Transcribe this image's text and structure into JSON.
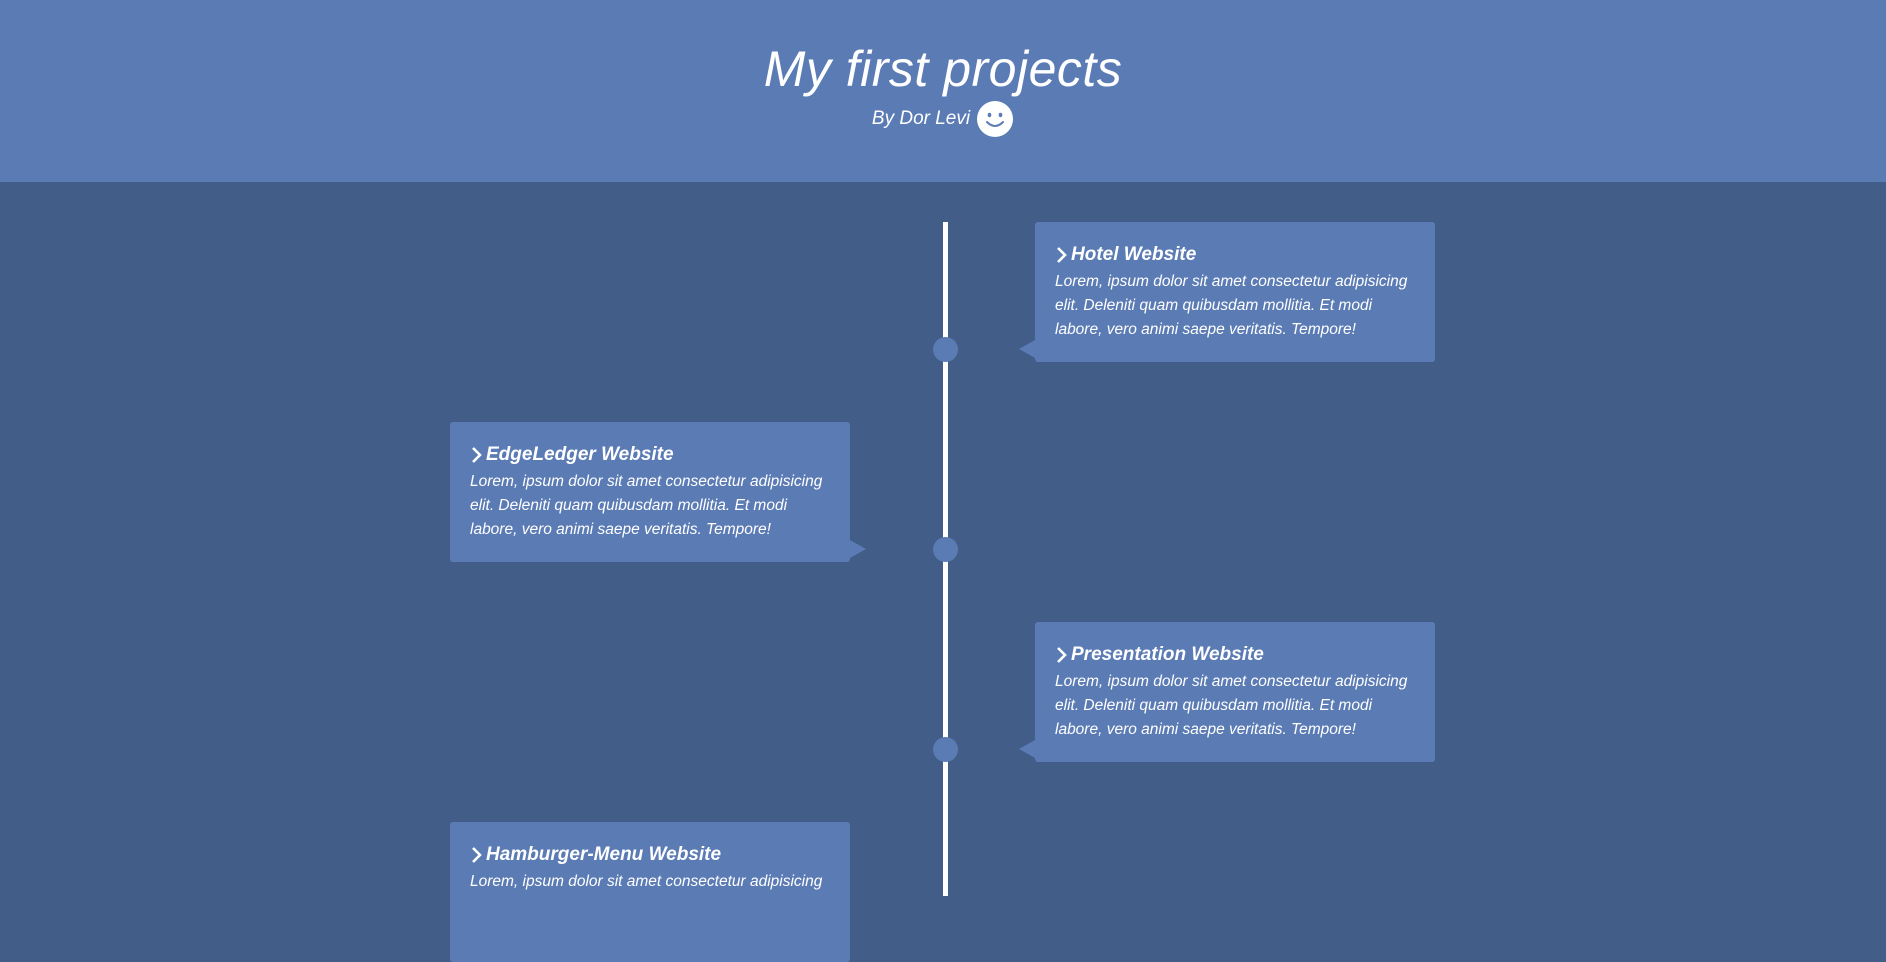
{
  "header": {
    "title": "My first projects",
    "byline": "By Dor Levi",
    "emoji_icon": "smiley-face-icon"
  },
  "timeline": {
    "items": [
      {
        "title": "Hotel Website",
        "description": "Lorem, ipsum dolor sit amet consectetur adipisicing elit. Deleniti quam quibusdam mollitia. Et modi labore, vero animi saepe veritatis. Tempore!"
      },
      {
        "title": "EdgeLedger Website",
        "description": "Lorem, ipsum dolor sit amet consectetur adipisicing elit. Deleniti quam quibusdam mollitia. Et modi labore, vero animi saepe veritatis. Tempore!"
      },
      {
        "title": "Presentation Website",
        "description": "Lorem, ipsum dolor sit amet consectetur adipisicing elit. Deleniti quam quibusdam mollitia. Et modi labore, vero animi saepe veritatis. Tempore!"
      },
      {
        "title": "Hamburger-Menu Website",
        "description": "Lorem, ipsum dolor sit amet consectetur adipisicing"
      }
    ]
  },
  "colors": {
    "background": "#425d88",
    "accent": "#5b7bb5",
    "line": "#ffffff"
  }
}
